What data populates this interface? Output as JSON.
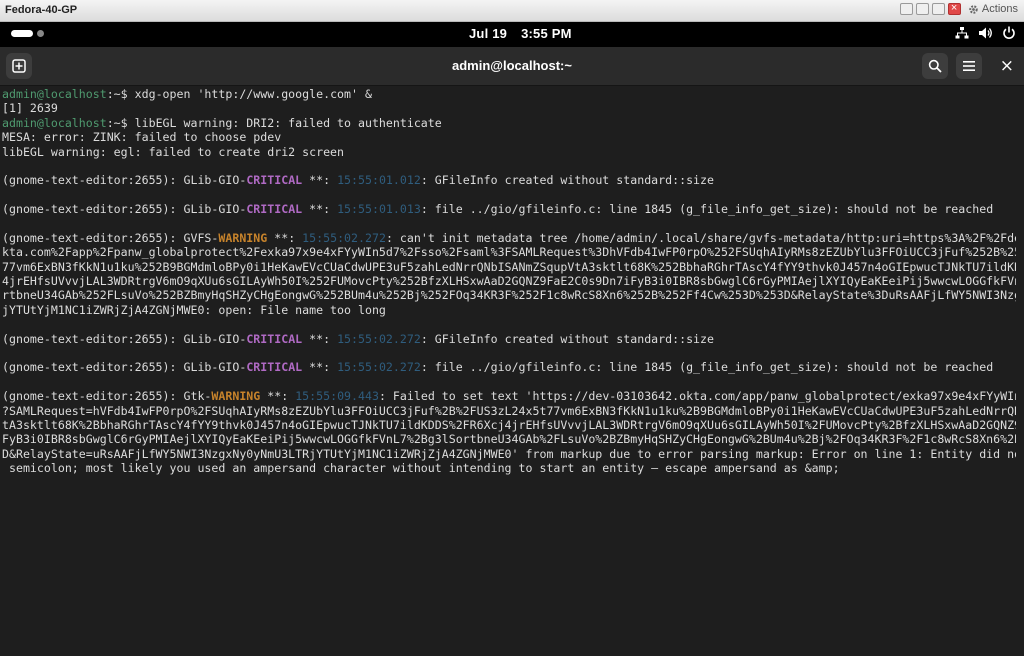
{
  "vm": {
    "title": "Fedora-40-GP",
    "actions_label": "Actions"
  },
  "topbar": {
    "date": "Jul 19",
    "time": "3:55 PM"
  },
  "terminal": {
    "title": "admin@localhost:~",
    "icons": [
      "new-tab-icon",
      "search-icon",
      "menu-icon",
      "close-icon"
    ],
    "colors": {
      "prompt": "#4f9a6f",
      "critical": "#b06ac4",
      "warning": "#c7832b",
      "timestamp": "#2f5d7e",
      "text": "#dcdcdc"
    },
    "lines": [
      [
        {
          "t": "admin@localhost",
          "c": "prompt"
        },
        {
          "t": ":~$ xdg-open 'http://www.google.com' &"
        }
      ],
      [
        {
          "t": "[1] 2639"
        }
      ],
      [
        {
          "t": "admin@localhost",
          "c": "prompt"
        },
        {
          "t": ":~$ libEGL warning: DRI2: failed to authenticate"
        }
      ],
      [
        {
          "t": "MESA: error: ZINK: failed to choose pdev"
        }
      ],
      [
        {
          "t": "libEGL warning: egl: failed to create dri2 screen"
        }
      ],
      [
        {
          "t": ""
        }
      ],
      [
        {
          "t": "(gnome-text-editor:2655): GLib-GIO-"
        },
        {
          "t": "CRITICAL",
          "c": "crit"
        },
        {
          "t": " **: "
        },
        {
          "t": "15:55:01.012",
          "c": "ts"
        },
        {
          "t": ": GFileInfo created without standard::size"
        }
      ],
      [
        {
          "t": ""
        }
      ],
      [
        {
          "t": "(gnome-text-editor:2655): GLib-GIO-"
        },
        {
          "t": "CRITICAL",
          "c": "crit"
        },
        {
          "t": " **: "
        },
        {
          "t": "15:55:01.013",
          "c": "ts"
        },
        {
          "t": ": file ../gio/gfileinfo.c: line 1845 (g_file_info_get_size): should not be reached"
        }
      ],
      [
        {
          "t": ""
        }
      ],
      [
        {
          "t": "(gnome-text-editor:2655): GVFS-"
        },
        {
          "t": "WARNING",
          "c": "warn"
        },
        {
          "t": " **: "
        },
        {
          "t": "15:55:02.272",
          "c": "ts"
        },
        {
          "t": ": can't init metadata tree /home/admin/.local/share/gvfs-metadata/http:uri=https%3A%2F%2Fdev-03103642.o"
        }
      ],
      [
        {
          "t": "kta.com%2Fapp%2Fpanw_globalprotect%2Fexka97x9e4xFYyWIn5d7%2Fsso%2Fsaml%3FSAMLRequest%3DhVFdb4IwFP0rpO%252FSUqhAIyRMs8zEZUbYlu3FFOiUCC3jFuf%252B%252FUS3zL24x5t"
        }
      ],
      [
        {
          "t": "77vm6ExBN3fKkN1u1ku%252B9BGMdmloBPy0i1HeKawEVcCUaCdwUPE3uF5zahLedNrrQNbISANmZSqupVtA3sktlt68K%252BbhaRGhrTAscY4fYY9thvk0J457n4oGIEpwucTJNkTU7ildKDDS%252FR6Xcj"
        }
      ],
      [
        {
          "t": "4jrEHfsUVvvjLAL3WDRtrgV6mO9qXUu6sGILAyWh50I%252FUMovcPty%252BfzXLHSxwAaD2GQNZ9FaE2C0s9Dn7iFyB3i0IBR8sbGwglC6rGyPMIAejlXYIQyEaKEeiPij5wwcwLOGGfkFVnL7%252Bg3lSo"
        }
      ],
      [
        {
          "t": "rtbneU34GAb%252FLsuVo%252BZBmyHqSHZyCHgEongwG%252BUm4u%252Bj%252FOq34KR3F%252F1c8wRcS8Xn6%252B%252Ff4Cw%253D%253D&RelayState%3DuRsAAFjLfWY5NWI3NzgxNy0yNmU3LTR"
        }
      ],
      [
        {
          "t": "jYTUtYjM1NC1iZWRjZjA4ZGNjMWE0: open: File name too long"
        }
      ],
      [
        {
          "t": ""
        }
      ],
      [
        {
          "t": "(gnome-text-editor:2655): GLib-GIO-"
        },
        {
          "t": "CRITICAL",
          "c": "crit"
        },
        {
          "t": " **: "
        },
        {
          "t": "15:55:02.272",
          "c": "ts"
        },
        {
          "t": ": GFileInfo created without standard::size"
        }
      ],
      [
        {
          "t": ""
        }
      ],
      [
        {
          "t": "(gnome-text-editor:2655): GLib-GIO-"
        },
        {
          "t": "CRITICAL",
          "c": "crit"
        },
        {
          "t": " **: "
        },
        {
          "t": "15:55:02.272",
          "c": "ts"
        },
        {
          "t": ": file ../gio/gfileinfo.c: line 1845 (g_file_info_get_size): should not be reached"
        }
      ],
      [
        {
          "t": ""
        }
      ],
      [
        {
          "t": "(gnome-text-editor:2655): Gtk-"
        },
        {
          "t": "WARNING",
          "c": "warn"
        },
        {
          "t": " **: "
        },
        {
          "t": "15:55:09.443",
          "c": "ts"
        },
        {
          "t": ": Failed to set text 'https://dev-03103642.okta.com/app/panw_globalprotect/exka97x9e4xFYyWIn5d7/sso/saml"
        }
      ],
      [
        {
          "t": "?SAMLRequest=hVFdb4IwFP0rpO%2FSUqhAIyRMs8zEZUbYlu3FFOiUCC3jFuf%2B%2FUS3zL24x5t77vm6ExBN3fKkN1u1ku%2B9BGMdmloBPy0i1HeKawEVcCUaCdwUPE3uF5zahLedNrrQNbISANmZSqupV"
        }
      ],
      [
        {
          "t": "tA3sktlt68K%2BbhaRGhrTAscY4fYY9thvk0J457n4oGIEpwucTJNkTU7ildKDDS%2FR6Xcj4jrEHfsUVvvjLAL3WDRtrgV6mO9qXUu6sGILAyWh50I%2FUMovcPty%2BfzXLHSxwAaD2GQNZ9FaE2C0s9Dn7i"
        }
      ],
      [
        {
          "t": "FyB3i0IBR8sbGwglC6rGyPMIAejlXYIQyEaKEeiPij5wwcwLOGGfkFVnL7%2Bg3lSortbneU34GAb%2FLsuVo%2BZBmyHqSHZyCHgEongwG%2BUm4u%2Bj%2FOq34KR3F%2F1c8wRcS8Xn6%2B%2Ff4Cw%3D%3"
        }
      ],
      [
        {
          "t": "D&RelayState=uRsAAFjLfWY5NWI3NzgxNy0yNmU3LTRjYTUtYjM1NC1iZWRjZjA4ZGNjMWE0' from markup due to error parsing markup: Error on line 1: Entity did not end with a"
        }
      ],
      [
        {
          "t": " semicolon; most likely you used an ampersand character without intending to start an entity — escape ampersand as &amp;"
        }
      ]
    ]
  }
}
